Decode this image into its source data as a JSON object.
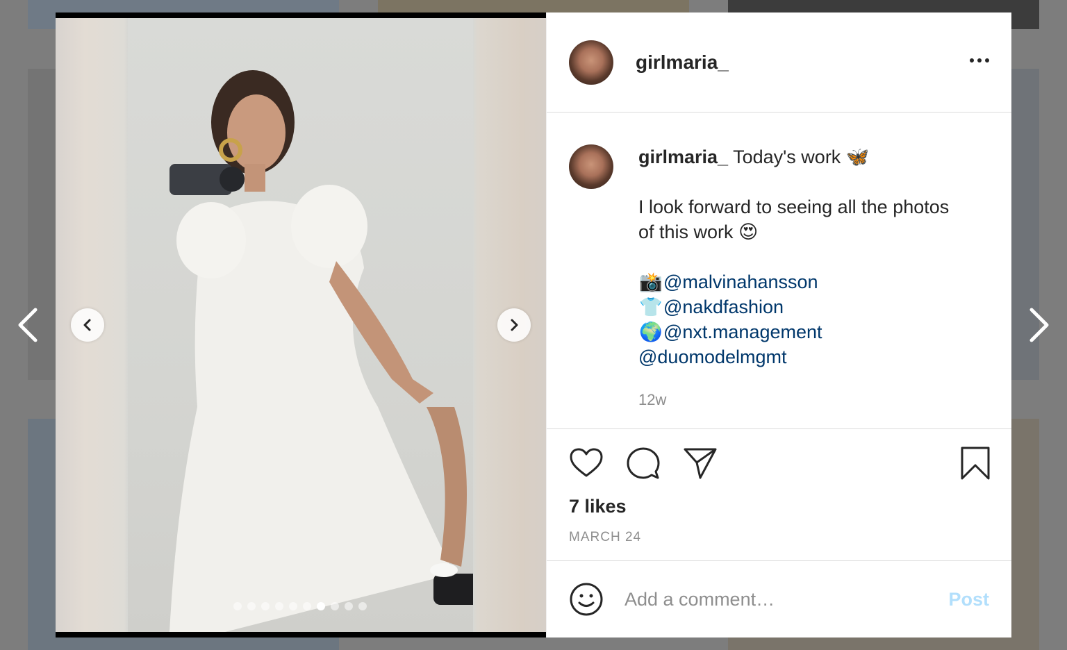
{
  "post": {
    "username": "girlmaria_",
    "caption": {
      "username": "girlmaria_",
      "line1": "Today's work",
      "line1_emoji": "🦋",
      "line2": "I look forward to seeing all the photos",
      "line3": "of this work",
      "line3_emoji": "😍",
      "credits": [
        {
          "emoji": "📸",
          "mention": "@malvinahansson"
        },
        {
          "emoji": "👕",
          "mention": "@nakdfashion"
        },
        {
          "emoji": "🌍",
          "mention": "@nxt.management"
        },
        {
          "emoji": "",
          "mention": "@duomodelmgmt"
        }
      ],
      "time_ago": "12w"
    },
    "likes": "7 likes",
    "date": "MARCH 24",
    "comment": {
      "placeholder": "Add a comment…",
      "post_label": "Post"
    },
    "carousel": {
      "total": 10,
      "active_index": 6
    }
  },
  "icons": {
    "outer_prev": "chevron-left-icon",
    "outer_next": "chevron-right-icon",
    "media_prev": "chevron-left-icon",
    "media_next": "chevron-right-icon",
    "more": "more-options-icon",
    "like": "heart-icon",
    "comment": "comment-icon",
    "share": "share-icon",
    "save": "bookmark-icon",
    "emoji": "smile-icon"
  },
  "colors": {
    "text": "#262626",
    "muted": "#8e8e8e",
    "link": "#00376b",
    "post_disabled": "#b2dffc",
    "overlay": "#7d7d7d"
  }
}
